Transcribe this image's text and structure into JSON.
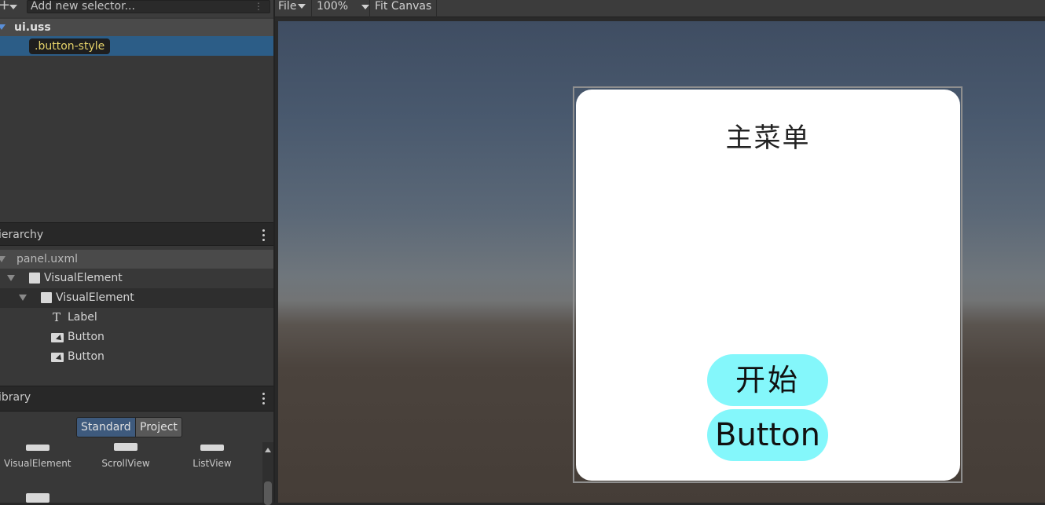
{
  "selectors": {
    "add_icon": "plus-icon",
    "input_placeholder": "Add new selector...",
    "options_glyph": "⋮",
    "stylesheet": "ui.uss",
    "selected_selector": ".button-style"
  },
  "hierarchy": {
    "header": "ierarchy",
    "root": "panel.uxml",
    "items": [
      {
        "label": "VisualElement",
        "icon": "visual-element-icon"
      },
      {
        "label": "VisualElement",
        "icon": "visual-element-icon"
      },
      {
        "label": "Label",
        "icon": "label-icon"
      },
      {
        "label": "Button",
        "icon": "button-icon"
      },
      {
        "label": "Button",
        "icon": "button-icon"
      }
    ]
  },
  "library": {
    "header": "ibrary",
    "tabs": [
      "Standard",
      "Project"
    ],
    "active_tab": "Standard",
    "items": [
      "VisualElement",
      "ScrollView",
      "ListView"
    ]
  },
  "toolbar": {
    "file": "File",
    "zoom": "100%",
    "fit": "Fit Canvas"
  },
  "canvas": {
    "title": "主菜单",
    "start_button": "开始",
    "second_button": "Button",
    "button_color": "#84f7fb",
    "card_color": "#ffffff"
  }
}
